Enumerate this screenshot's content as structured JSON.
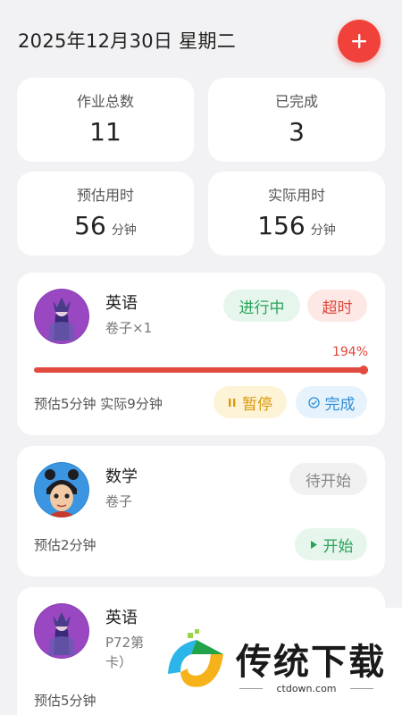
{
  "header": {
    "date": "2025年12月30日 星期二"
  },
  "stats": {
    "total_label": "作业总数",
    "total_value": "11",
    "done_label": "已完成",
    "done_value": "3",
    "est_label": "预估用时",
    "est_value": "56",
    "est_unit": "分钟",
    "actual_label": "实际用时",
    "actual_value": "156",
    "actual_unit": "分钟"
  },
  "tasks": [
    {
      "subject": "英语",
      "detail": "卷子×1",
      "status": "进行中",
      "overtime": "超时",
      "progress_text": "194%",
      "progress": 1.0,
      "time_text": "预估5分钟 实际9分钟",
      "pause_label": "暂停",
      "done_label": "完成"
    },
    {
      "subject": "数学",
      "detail": "卷子",
      "status": "待开始",
      "time_text": "预估2分钟",
      "start_label": "开始"
    },
    {
      "subject": "英语",
      "detail": "P72第",
      "detail2": "卡）",
      "time_text": "预估5分钟"
    }
  ],
  "watermark": {
    "text": "传统下载",
    "url": "ctdown.com"
  },
  "colors": {
    "accent_red": "#f0413a",
    "green": "#28a35a",
    "yellow": "#d89a08",
    "blue": "#2e8fd8"
  },
  "icons": [
    "plus-icon",
    "pause-icon",
    "check-circle-icon",
    "play-icon"
  ]
}
